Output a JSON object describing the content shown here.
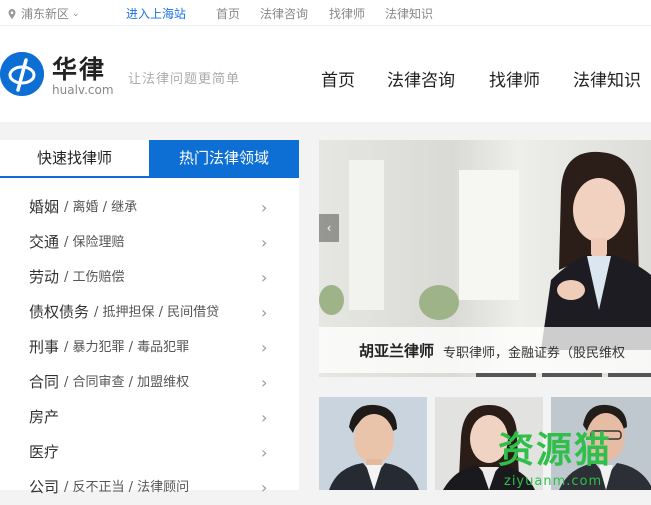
{
  "topbar": {
    "location": "浦东新区",
    "enter_station": "进入上海站",
    "nav": [
      "首页",
      "法律咨询",
      "找律师",
      "法律知识"
    ]
  },
  "header": {
    "brand": "华律",
    "domain": "hualv.com",
    "slogan": "让法律问题更简单",
    "nav": [
      "首页",
      "法律咨询",
      "找律师",
      "法律知识"
    ]
  },
  "tabs": [
    "快速找律师",
    "热门法律领域"
  ],
  "categories": [
    {
      "main": "婚姻",
      "subs": "/ 离婚 / 继承"
    },
    {
      "main": "交通",
      "subs": "/ 保险理赔"
    },
    {
      "main": "劳动",
      "subs": "/ 工伤赔偿"
    },
    {
      "main": "债权债务",
      "subs": "/ 抵押担保 / 民间借贷"
    },
    {
      "main": "刑事",
      "subs": "/ 暴力犯罪 / 毒品犯罪"
    },
    {
      "main": "合同",
      "subs": "/ 合同审查 / 加盟维权"
    },
    {
      "main": "房产",
      "subs": ""
    },
    {
      "main": "医疗",
      "subs": ""
    },
    {
      "main": "公司",
      "subs": "/ 反不正当 / 法律顾问"
    }
  ],
  "banner": {
    "name": "胡亚兰律师",
    "desc": "专职律师，金融证券（股民维权",
    "prev_arrow": "‹"
  },
  "watermark": {
    "text": "资源猫",
    "url": "ziyuanm.com"
  },
  "colors": {
    "accent": "#0d6fd4",
    "watermark": "#2fbf4a"
  }
}
